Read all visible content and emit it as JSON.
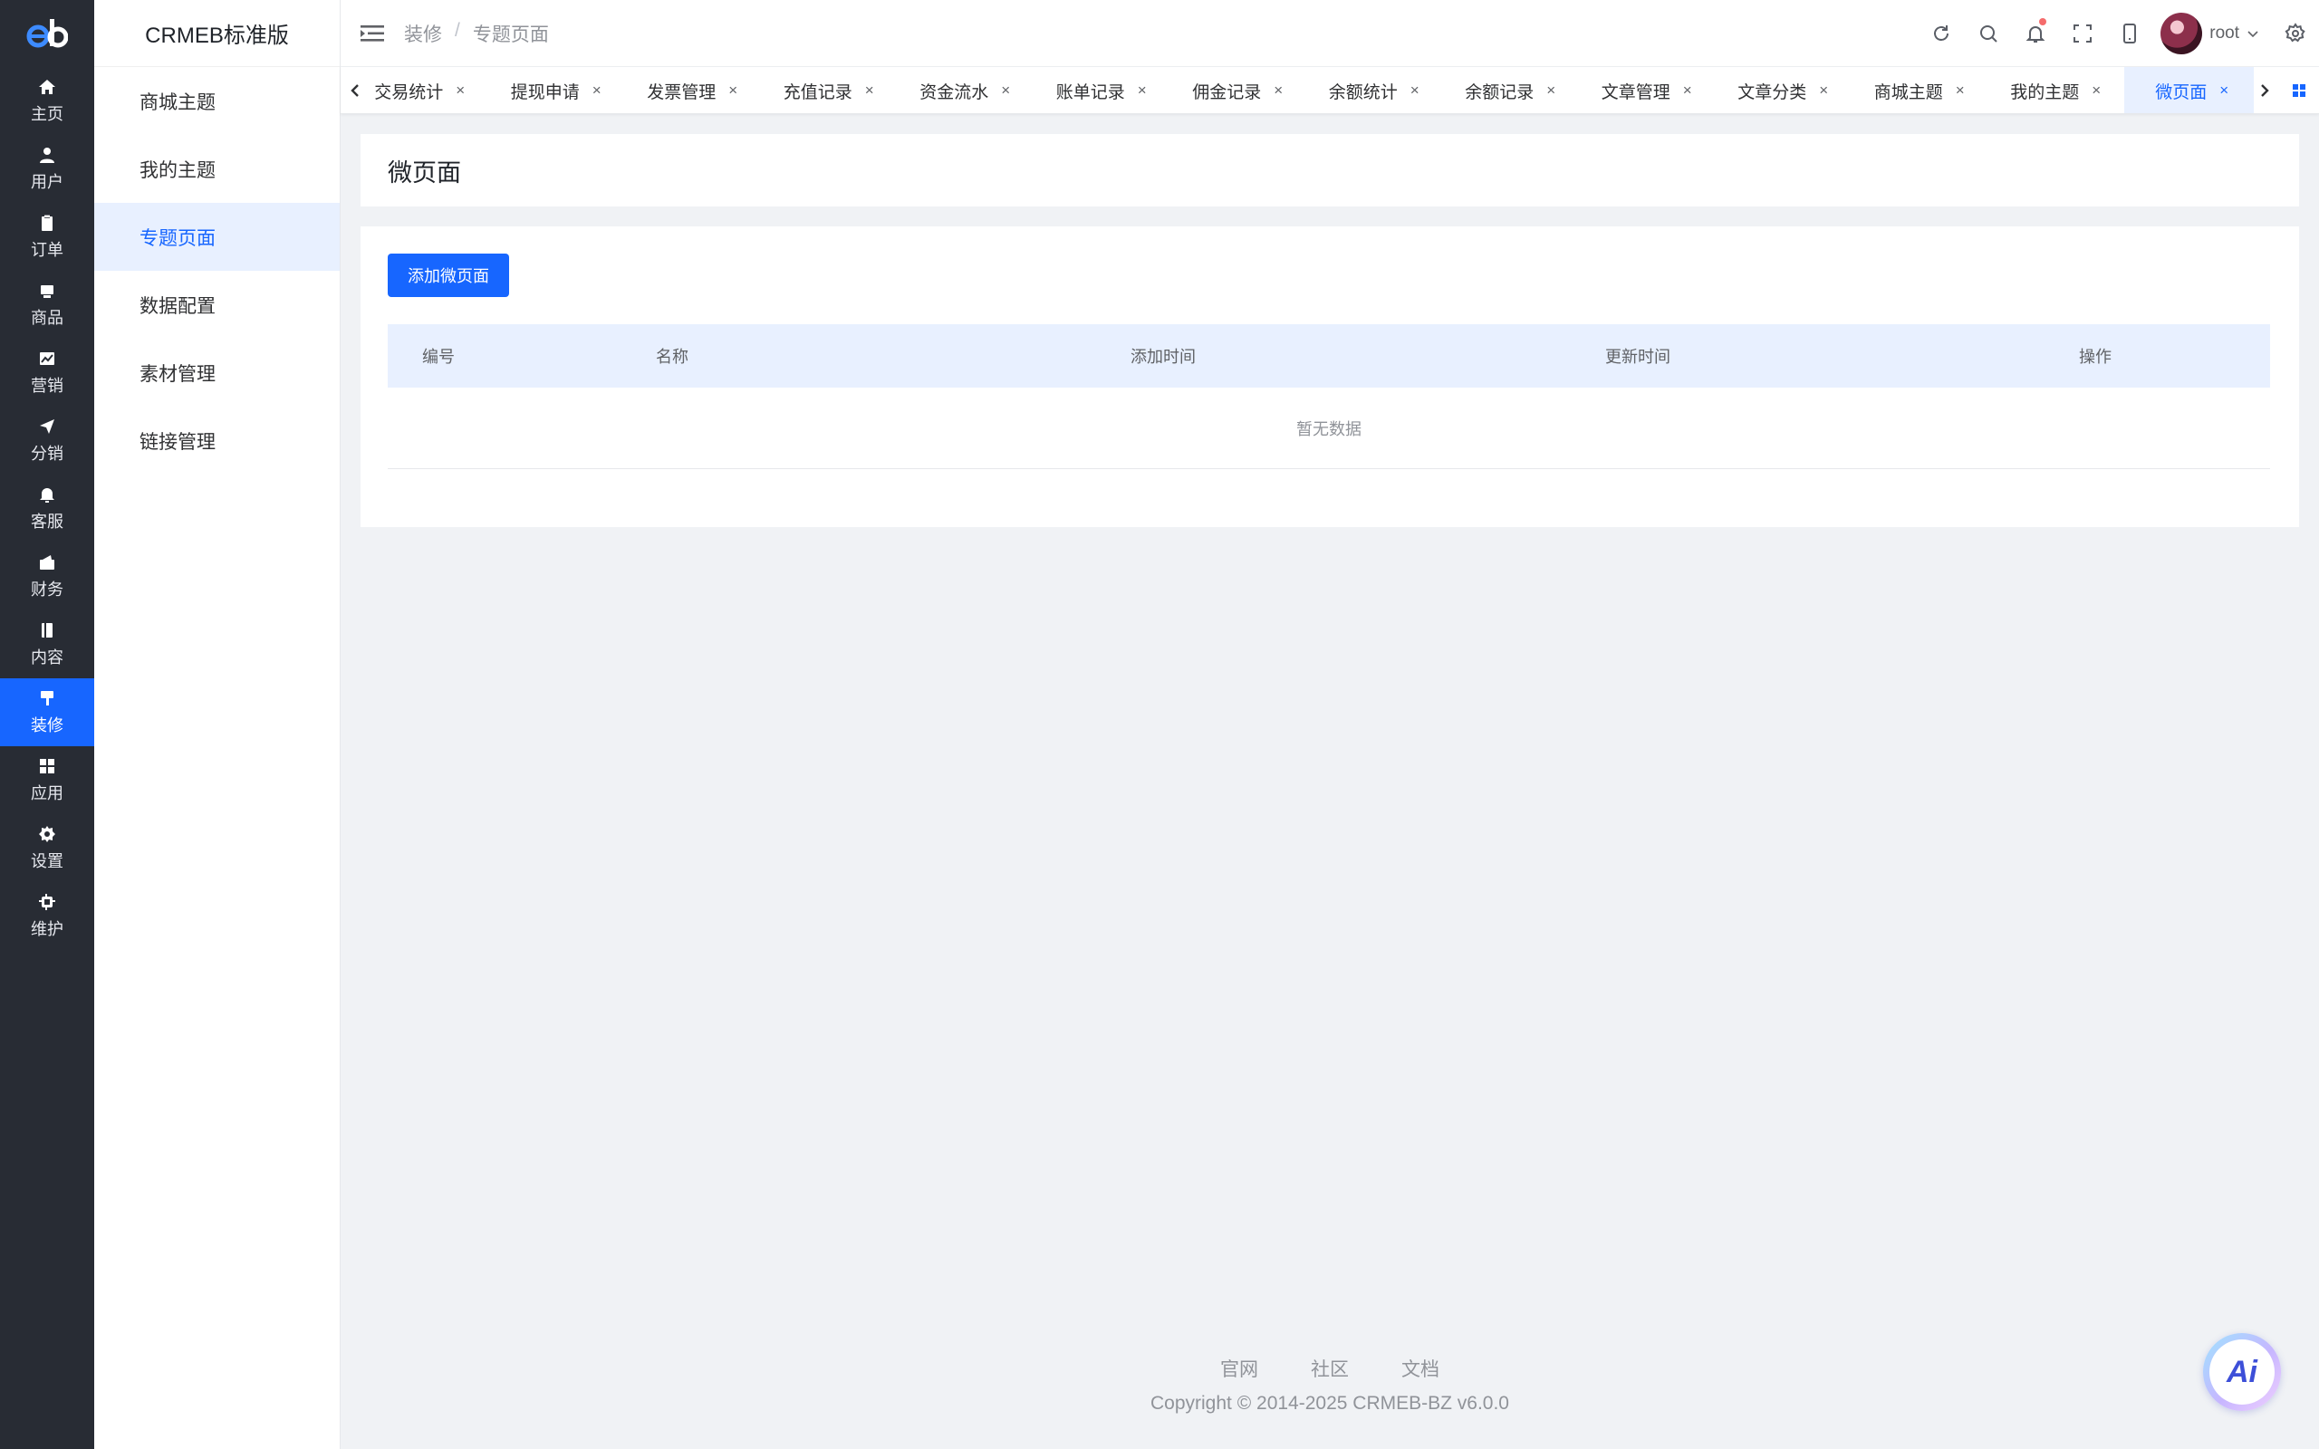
{
  "rail": {
    "logo": "eb",
    "items": [
      {
        "label": "主页",
        "icon": "home-icon"
      },
      {
        "label": "用户",
        "icon": "user-icon"
      },
      {
        "label": "订单",
        "icon": "clipboard-icon"
      },
      {
        "label": "商品",
        "icon": "box-icon"
      },
      {
        "label": "营销",
        "icon": "chart-icon"
      },
      {
        "label": "分销",
        "icon": "send-icon"
      },
      {
        "label": "客服",
        "icon": "bell-icon"
      },
      {
        "label": "财务",
        "icon": "wallet-icon"
      },
      {
        "label": "内容",
        "icon": "book-icon"
      },
      {
        "label": "装修",
        "icon": "brush-icon"
      },
      {
        "label": "应用",
        "icon": "grid-icon"
      },
      {
        "label": "设置",
        "icon": "gear-icon"
      },
      {
        "label": "维护",
        "icon": "cpu-icon"
      }
    ],
    "active_index": 9
  },
  "submenu": {
    "title": "CRMEB标准版",
    "items": [
      "商城主题",
      "我的主题",
      "专题页面",
      "数据配置",
      "素材管理",
      "链接管理"
    ],
    "active_index": 2
  },
  "header": {
    "breadcrumb": [
      "装修",
      "专题页面"
    ],
    "breadcrumb_sep": "/",
    "username": "root"
  },
  "tags": {
    "items": [
      "交易统计",
      "提现申请",
      "发票管理",
      "充值记录",
      "资金流水",
      "账单记录",
      "佣金记录",
      "余额统计",
      "余额记录",
      "文章管理",
      "文章分类",
      "商城主题",
      "我的主题",
      "微页面"
    ],
    "active_index": 13,
    "close_glyph": "×"
  },
  "page": {
    "title": "微页面",
    "add_button": "添加微页面",
    "columns": [
      "编号",
      "名称",
      "添加时间",
      "更新时间",
      "操作"
    ],
    "empty_text": "暂无数据"
  },
  "footer": {
    "links": [
      "官网",
      "社区",
      "文档"
    ],
    "copyright": "Copyright © 2014-2025 CRMEB-BZ v6.0.0"
  },
  "ai_button": "Ai",
  "colors": {
    "primary": "#1766ff",
    "rail_bg": "#282c34",
    "active_light": "#e8f0ff"
  }
}
